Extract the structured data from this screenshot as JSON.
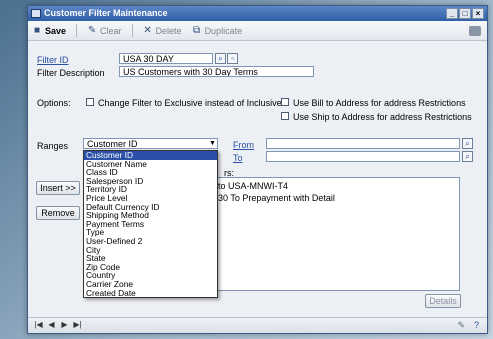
{
  "window": {
    "title": "Customer Filter Maintenance",
    "controls": [
      "_",
      "□",
      "×"
    ]
  },
  "toolbar": {
    "save": "Save",
    "clear": "Clear",
    "delete": "Delete",
    "duplicate": "Duplicate"
  },
  "form": {
    "filter_id_label": "Filter ID",
    "filter_id_value": "USA 30 DAY",
    "filter_desc_label": "Filter Description",
    "filter_desc_value": "US Customers with 30 Day Terms",
    "options_label": "Options:",
    "option_exclusive": "Change Filter to Exclusive instead of Inclusive",
    "option_bill_to": "Use Bill to Address for address Restrictions",
    "option_ship_to": "Use Ship to Address for address Restrictions",
    "ranges_label": "Ranges",
    "ranges_selected": "Customer ID",
    "from_label": "From",
    "to_label": "To",
    "restrictions_label": "rs:",
    "restrictions": [
      "to USA-MNWI-T4",
      "30 To Prepayment with Detail"
    ],
    "insert_button": "Insert >>",
    "remove_button": "Remove",
    "details_button": "Details"
  },
  "dropdown_options": [
    "Customer ID",
    "Customer Name",
    "Class ID",
    "Salesperson ID",
    "Territory ID",
    "Price Level",
    "Default Currency ID",
    "Shipping Method",
    "Payment Terms",
    "Type",
    "User-Defined 2",
    "City",
    "State",
    "Zip Code",
    "Country",
    "Carrier Zone",
    "Created Date"
  ],
  "colors": {
    "accent": "#2b50a8",
    "title_bar": "#2f5ea8",
    "link": "#2a4fa3"
  }
}
